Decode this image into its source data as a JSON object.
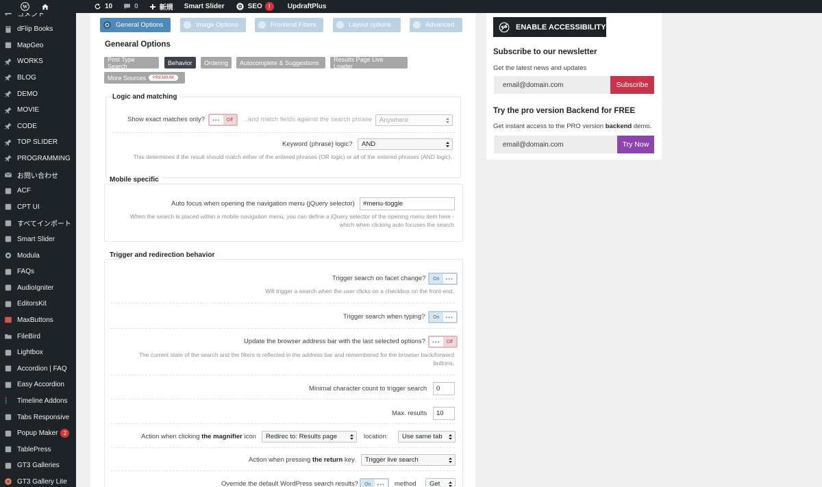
{
  "adminbar": {
    "updates_count": "10",
    "comments_count": "0",
    "new_label": "新規",
    "smart_slider": "Smart Slider",
    "seo_label": "SEO",
    "seo_badge": "!",
    "updraft": "UpdraftPlus"
  },
  "sidebar": {
    "items": [
      {
        "label": "コメント",
        "icon": "comment-icon"
      },
      {
        "label": "dFlip Books",
        "icon": "book-icon"
      },
      {
        "label": "MapGeo",
        "icon": "map-icon"
      },
      {
        "label": "WORKS",
        "icon": "pin-icon"
      },
      {
        "label": "BLOG",
        "icon": "pin-icon"
      },
      {
        "label": "DEMO",
        "icon": "pin-icon"
      },
      {
        "label": "MOVIE",
        "icon": "pin-icon"
      },
      {
        "label": "CODE",
        "icon": "pin-icon"
      },
      {
        "label": "TOP SLIDER",
        "icon": "pin-icon"
      },
      {
        "label": "PROGRAMMING",
        "icon": "pin-icon"
      },
      {
        "label": "お問い合わせ",
        "icon": "mail-icon"
      },
      {
        "label": "ACF",
        "icon": "acf-icon"
      },
      {
        "label": "CPT UI",
        "icon": "grid-icon"
      },
      {
        "label": "すべてインポート",
        "icon": "import-icon"
      },
      {
        "label": "Smart Slider",
        "icon": "slider-icon"
      },
      {
        "label": "Modula",
        "icon": "gear-icon"
      },
      {
        "label": "FAQs",
        "icon": "faq-icon"
      },
      {
        "label": "AudioIgniter",
        "icon": "audio-icon"
      },
      {
        "label": "EditorsKit",
        "icon": "edit-icon"
      },
      {
        "label": "MaxButtons",
        "icon": "maxbuttons-icon"
      },
      {
        "label": "FileBird",
        "icon": "folder-icon"
      },
      {
        "label": "Lightbox",
        "icon": "lightbox-icon"
      },
      {
        "label": "Accordion | FAQ",
        "icon": "accordion-icon"
      },
      {
        "label": "Easy Accordion",
        "icon": "accordion-icon"
      },
      {
        "label": "Timeline Addons",
        "icon": "timeline-icon"
      },
      {
        "label": "Tabs Responsive",
        "icon": "tabs-icon"
      },
      {
        "label": "Popup Maker",
        "icon": "popup-icon",
        "badge": "2"
      },
      {
        "label": "TablePress",
        "icon": "table-icon"
      },
      {
        "label": "GT3 Galleries",
        "icon": "gallery-icon"
      },
      {
        "label": "GT3 Gallery Lite",
        "icon": "gallery-lite-icon"
      }
    ]
  },
  "tabs": [
    {
      "label": "General Options",
      "active": true
    },
    {
      "label": "Image Options",
      "active": false
    },
    {
      "label": "Frontend Filters",
      "active": false
    },
    {
      "label": "Layout options",
      "active": false
    },
    {
      "label": "Advanced",
      "active": false
    }
  ],
  "section_title": "Genearal Options",
  "subtabs": {
    "post_type_search": "Post Type Search",
    "behavior": "Behavior",
    "ordering": "Ordering",
    "autocomplete": "Autocomplete & Suggestions",
    "results_live": "Results Page Live Loader",
    "more_sources": "More Sources",
    "premium": "PREMIUM"
  },
  "logic": {
    "title": "Logic and matching",
    "exact_label": "Show exact matches only?",
    "exact_toggle": "Off",
    "match_label": "...and match fields against the search phrase",
    "match_value": "Anywhere",
    "keyword_label": "Keyword (phrase) logic?",
    "keyword_value": "AND",
    "keyword_desc": "This determines if the result should match either of the entered phrases (OR logic) or all of the entered phrases (AND logic)."
  },
  "mobile": {
    "title": "Mobile specific",
    "autofocus_label": "Auto focus when opening the navigation menu (jQuery selector)",
    "autofocus_value": "#menu-toggle",
    "desc_line1": "When the search is placed within a mobile navigation menu, you can define a jQuery selector of the opening menu item here -",
    "desc_line2": "which when clicking auto focuses the search"
  },
  "trigger": {
    "title": "Trigger and redirection behavior",
    "facet_label": "Trigger search on facet change?",
    "facet_toggle": "On",
    "facet_desc": "Will trigger a search when the user clicks on a checkbox on the front-end.",
    "typing_label": "Trigger search when typing?",
    "typing_toggle": "On",
    "address_label": "Update the browser address bar with the last selected options?",
    "address_toggle": "Off",
    "address_desc1": "The current state of the search and the filters is reflected in the address bar and remembered for the browser back/forward",
    "address_desc2": "buttons.",
    "min_char_label": "Minimal character count to trigger search",
    "min_char_value": "0",
    "max_results_label": "Max. results",
    "max_results_value": "10",
    "magnifier_pre": "Action when clicking ",
    "magnifier_bold": "the magnifier",
    "magnifier_post": " icon",
    "magnifier_value": "Redirec to: Results page",
    "location_label": "location:",
    "location_value": "Use same tab",
    "return_pre": "Action when pressing ",
    "return_bold": "the return",
    "return_post": " key",
    "return_value": "Trigger live search",
    "override_label": "Override the default WordPress search results?",
    "override_toggle": "On",
    "method_label": "method",
    "method_value": "Get"
  },
  "right_panel": {
    "accessibility_button": "ENABLE ACCESSIBILITY",
    "newsletter_title": "Subscribe to our newsletter",
    "newsletter_text": "Get the latest news and updates",
    "email_placeholder": "email@domain.com",
    "subscribe_button": "Subscribe",
    "pro_title": "Try the pro version Backend for FREE",
    "pro_text_pre": "Get instant access to the PRO version ",
    "pro_text_bold": "backend",
    "pro_text_post": " demo.",
    "email_placeholder2": "email@domain.com",
    "try_button": "Try Now"
  },
  "colors": {
    "subscribe": "#c9344c",
    "try_now": "#8e44ad",
    "tab_active": "#4c8bb9",
    "tab_inactive": "#b9d3e5"
  }
}
